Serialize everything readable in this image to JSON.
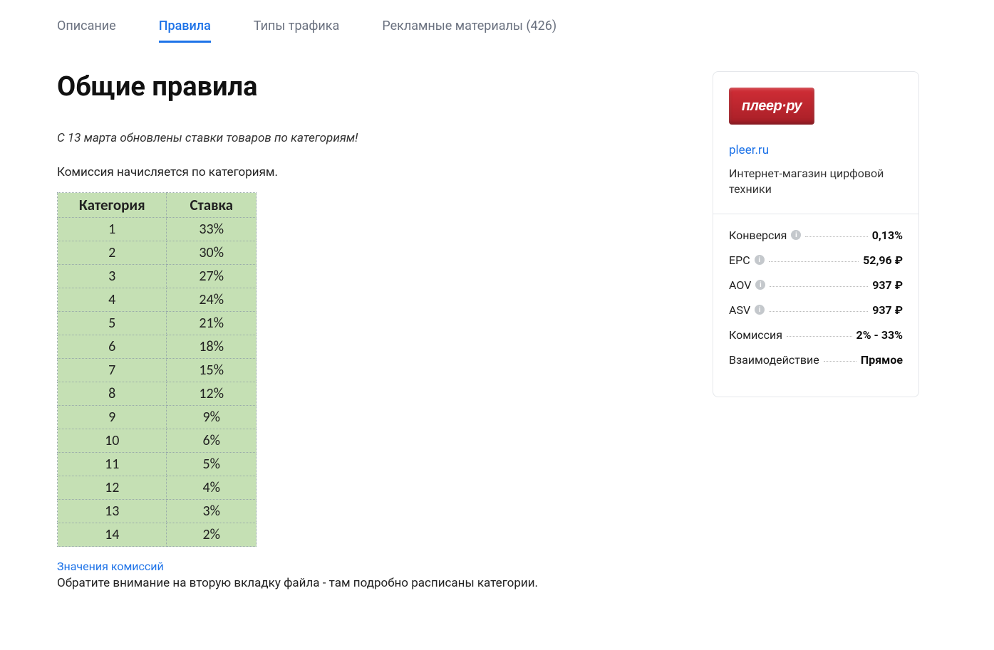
{
  "tabs": [
    {
      "label": "Описание",
      "active": false
    },
    {
      "label": "Правила",
      "active": true
    },
    {
      "label": "Типы трафика",
      "active": false
    },
    {
      "label": "Рекламные материалы (426)",
      "active": false
    }
  ],
  "main": {
    "title": "Общие правила",
    "update_notice": "С 13 марта обновлены ставки товаров по категориям!",
    "intro": "Комиссия начисляется по категориям.",
    "table": {
      "head_category": "Категория",
      "head_rate": "Ставка",
      "rows": [
        {
          "cat": "1",
          "rate": "33%"
        },
        {
          "cat": "2",
          "rate": "30%"
        },
        {
          "cat": "3",
          "rate": "27%"
        },
        {
          "cat": "4",
          "rate": "24%"
        },
        {
          "cat": "5",
          "rate": "21%"
        },
        {
          "cat": "6",
          "rate": "18%"
        },
        {
          "cat": "7",
          "rate": "15%"
        },
        {
          "cat": "8",
          "rate": "12%"
        },
        {
          "cat": "9",
          "rate": "9%"
        },
        {
          "cat": "10",
          "rate": "6%"
        },
        {
          "cat": "11",
          "rate": "5%"
        },
        {
          "cat": "12",
          "rate": "4%"
        },
        {
          "cat": "13",
          "rate": "3%"
        },
        {
          "cat": "14",
          "rate": "2%"
        }
      ]
    },
    "commission_link": "Значения комиссий",
    "footnote": "Обратите внимание на вторую вкладку файла - там подробно расписаны категории."
  },
  "sidebar": {
    "brand_logo_text": "плеер·ру",
    "brand_link": "pleer.ru",
    "brand_desc": "Интернет-магазин цирфовой техники",
    "stats": [
      {
        "label": "Конверсия",
        "info": true,
        "value": "0,13%"
      },
      {
        "label": "EPC",
        "info": true,
        "value": "52,96 ₽"
      },
      {
        "label": "AOV",
        "info": true,
        "value": "937 ₽"
      },
      {
        "label": "ASV",
        "info": true,
        "value": "937 ₽"
      },
      {
        "label": "Комиссия",
        "info": false,
        "value": "2% - 33%"
      },
      {
        "label": "Взаимодействие",
        "info": false,
        "value": "Прямое"
      }
    ]
  }
}
